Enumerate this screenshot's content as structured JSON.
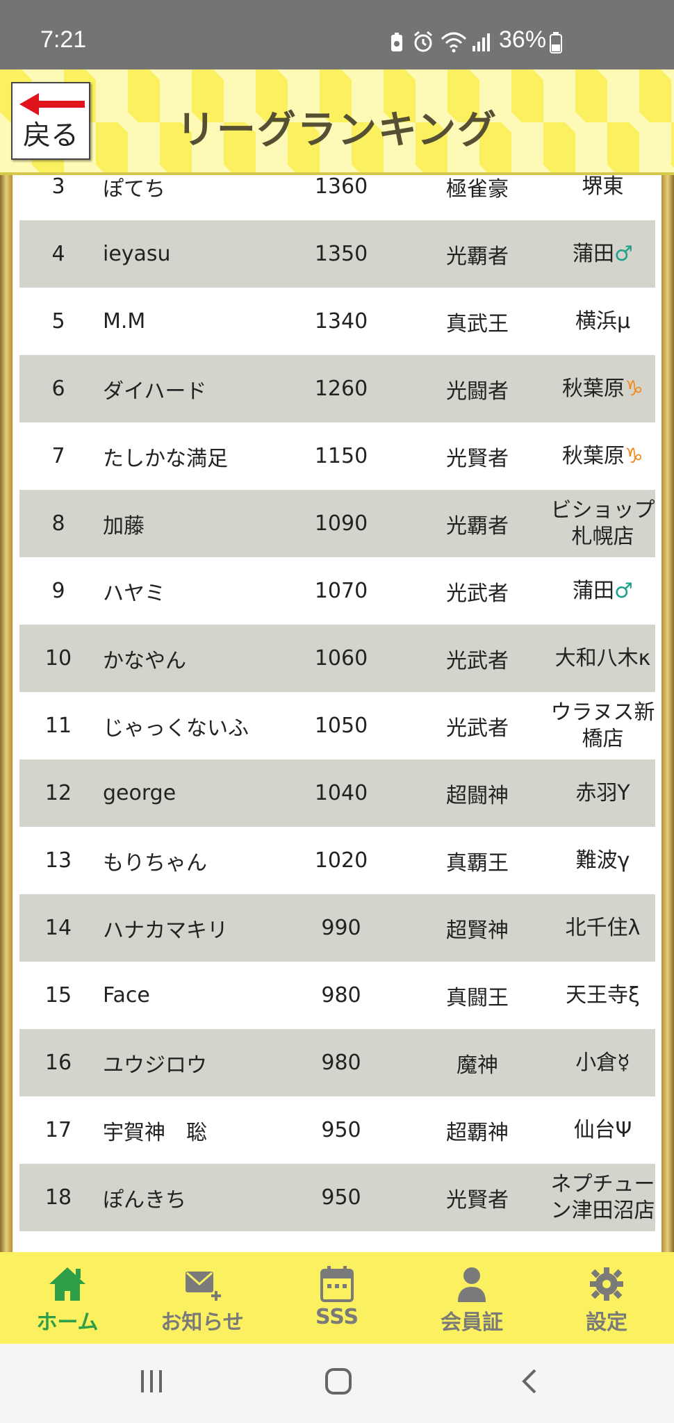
{
  "status_bar": {
    "time": "7:21",
    "battery": "36%"
  },
  "header": {
    "title": "リーグランキング",
    "back_label": "戻る"
  },
  "colors": {
    "header_yellow": "#fbf160",
    "row_gray": "#d4d4cc",
    "nav_active": "#2e9e48",
    "nav_inactive": "#7a7a7a",
    "mars_mark": "#1fa38d",
    "cap_mark": "#f08a1c"
  },
  "rankings": [
    {
      "rank": "3",
      "name": "ぽてち",
      "score": "1360",
      "title": "極雀豪",
      "shop": "堺東",
      "mark": ""
    },
    {
      "rank": "4",
      "name": "ieyasu",
      "score": "1350",
      "title": "光覇者",
      "shop": "蒲田",
      "mark": "♂"
    },
    {
      "rank": "5",
      "name": "M.M",
      "score": "1340",
      "title": "真武王",
      "shop": "横浜μ",
      "mark": ""
    },
    {
      "rank": "6",
      "name": "ダイハード",
      "score": "1260",
      "title": "光闘者",
      "shop": "秋葉原",
      "mark": "♑"
    },
    {
      "rank": "7",
      "name": "たしかな満足",
      "score": "1150",
      "title": "光賢者",
      "shop": "秋葉原",
      "mark": "♑"
    },
    {
      "rank": "8",
      "name": "加藤",
      "score": "1090",
      "title": "光覇者",
      "shop": "ビショップ札幌店",
      "mark": ""
    },
    {
      "rank": "9",
      "name": "ハヤミ",
      "score": "1070",
      "title": "光武者",
      "shop": "蒲田",
      "mark": "♂"
    },
    {
      "rank": "10",
      "name": "かなやん",
      "score": "1060",
      "title": "光武者",
      "shop": "大和八木κ",
      "mark": ""
    },
    {
      "rank": "11",
      "name": "じゃっくないふ",
      "score": "1050",
      "title": "光武者",
      "shop": "ウラヌス新橋店",
      "mark": ""
    },
    {
      "rank": "12",
      "name": "george",
      "score": "1040",
      "title": "超闘神",
      "shop": "赤羽Y",
      "mark": ""
    },
    {
      "rank": "13",
      "name": "もりちゃん",
      "score": "1020",
      "title": "真覇王",
      "shop": "難波γ",
      "mark": ""
    },
    {
      "rank": "14",
      "name": "ハナカマキリ",
      "score": "990",
      "title": "超賢神",
      "shop": "北千住λ",
      "mark": ""
    },
    {
      "rank": "15",
      "name": "Face",
      "score": "980",
      "title": "真闘王",
      "shop": "天王寺ξ",
      "mark": ""
    },
    {
      "rank": "16",
      "name": "ユウジロウ",
      "score": "980",
      "title": "魔神",
      "shop": "小倉☿",
      "mark": ""
    },
    {
      "rank": "17",
      "name": "宇賀神　聡",
      "score": "950",
      "title": "超覇神",
      "shop": "仙台Ψ",
      "mark": ""
    },
    {
      "rank": "18",
      "name": "ぽんきち",
      "score": "950",
      "title": "光賢者",
      "shop": "ネプチューン津田沼店",
      "mark": ""
    }
  ],
  "bottom_nav": {
    "home": "ホーム",
    "news": "お知らせ",
    "sss": "SSS",
    "member": "会員証",
    "settings": "設定"
  }
}
